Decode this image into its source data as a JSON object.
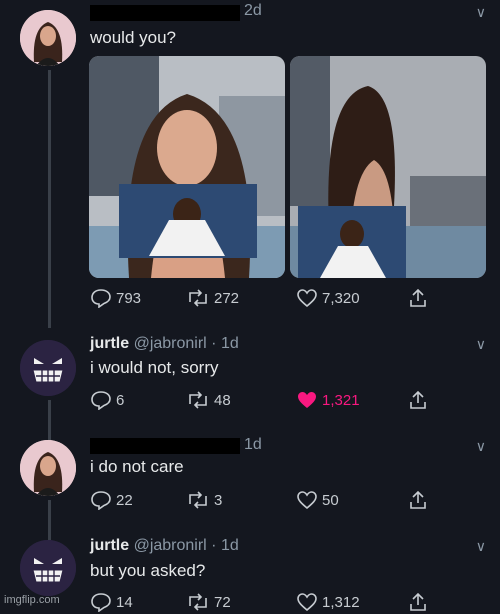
{
  "tweets": [
    {
      "handle_time": "2d",
      "text": "would you?",
      "reply_count": "793",
      "retweet_count": "272",
      "like_count": "7,320"
    },
    {
      "display_name": "jurtle",
      "handle_time": "@jabronirl · 1d",
      "text": "i would not, sorry",
      "reply_count": "6",
      "retweet_count": "48",
      "like_count": "1,321",
      "liked": true
    },
    {
      "handle_time": "1d",
      "text": "i do not care",
      "reply_count": "22",
      "retweet_count": "3",
      "like_count": "50"
    },
    {
      "display_name": "jurtle",
      "handle_time": "@jabronirl · 1d",
      "text": "but you asked?",
      "reply_count": "14",
      "retweet_count": "72",
      "like_count": "1,312"
    }
  ],
  "watermark": "imgflip.com",
  "colors": {
    "background": "#14171f",
    "like_active": "#f91880",
    "muted": "#8b98a5"
  }
}
